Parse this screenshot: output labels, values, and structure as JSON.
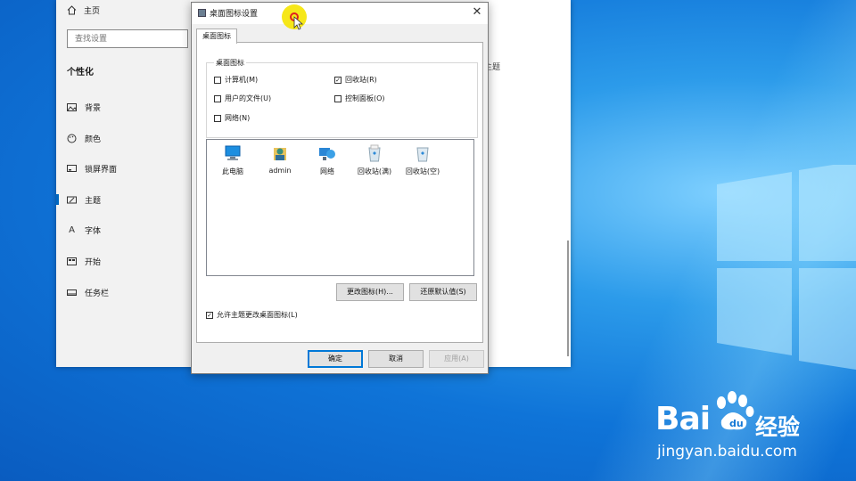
{
  "settings": {
    "home_label": "主页",
    "search_placeholder": "查找设置",
    "section_title": "个性化",
    "nav_items": [
      {
        "label": "背景",
        "icon": "image-icon"
      },
      {
        "label": "颜色",
        "icon": "palette-icon"
      },
      {
        "label": "锁屏界面",
        "icon": "lock-screen-icon"
      },
      {
        "label": "主题",
        "icon": "theme-icon"
      },
      {
        "label": "字体",
        "icon": "font-icon"
      },
      {
        "label": "开始",
        "icon": "start-icon"
      },
      {
        "label": "任务栏",
        "icon": "taskbar-icon"
      }
    ],
    "active_item": "主题",
    "right_fragment": "主题"
  },
  "dialog": {
    "title": "桌面图标设置",
    "tab_label": "桌面图标",
    "group_label": "桌面图标",
    "checkboxes": [
      {
        "label": "计算机(M)",
        "checked": false
      },
      {
        "label": "回收站(R)",
        "checked": true
      },
      {
        "label": "用户的文件(U)",
        "checked": false
      },
      {
        "label": "控制面板(O)",
        "checked": false
      },
      {
        "label": "网络(N)",
        "checked": false
      }
    ],
    "icons": [
      {
        "label": "此电脑",
        "icon": "computer-icon"
      },
      {
        "label": "admin",
        "icon": "user-folder-icon"
      },
      {
        "label": "网络",
        "icon": "network-icon"
      },
      {
        "label": "回收站(满)",
        "icon": "recycle-bin-full-icon"
      },
      {
        "label": "回收站(空)",
        "icon": "recycle-bin-empty-icon"
      }
    ],
    "change_icon_label": "更改图标(H)...",
    "restore_default_label": "还原默认值(S)",
    "allow_themes_label": "允许主题更改桌面图标(L)",
    "allow_themes_checked": true,
    "ok_label": "确定",
    "cancel_label": "取消",
    "apply_label": "应用(A)"
  },
  "watermark": {
    "brand": "Bai",
    "brand_tail": "经验",
    "url": "jingyan.baidu.com"
  },
  "colors": {
    "accent": "#0078d7",
    "desktop": "#0f74d8"
  }
}
